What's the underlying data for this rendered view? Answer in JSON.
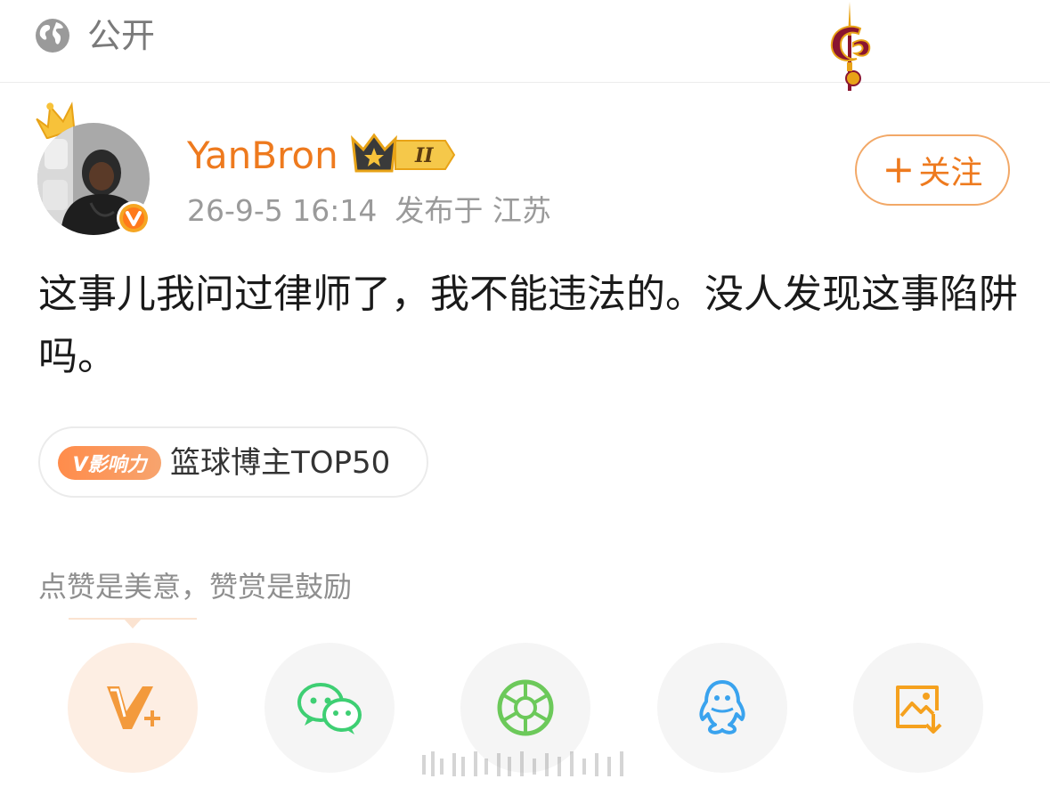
{
  "header": {
    "visibility_icon": "globe-icon",
    "visibility_label": "公开",
    "team_logo_icon": "basketball-team-logo"
  },
  "author": {
    "name": "YanBron",
    "crown_icon": "crown-icon",
    "verified_icon": "verified-v-icon",
    "rank_badge_icon": "crown-rank-badge",
    "rank_level": "II",
    "date": "26-9-5 16:14",
    "location": "发布于 江苏",
    "name_color": "#ee7a1e"
  },
  "follow_button": {
    "label": "关注",
    "icon": "plus-icon"
  },
  "post": {
    "text": "这事儿我问过律师了，我不能违法的。没人发现这事陷阱吗。"
  },
  "influence_tag": {
    "badge": "V影响力",
    "label": "篮球博主TOP50"
  },
  "reward": {
    "note": "点赞是美意，赞赏是鼓励"
  },
  "share_actions": [
    {
      "icon": "v-plus-icon"
    },
    {
      "icon": "wechat-icon"
    },
    {
      "icon": "moments-icon"
    },
    {
      "icon": "qq-icon"
    },
    {
      "icon": "save-image-icon"
    }
  ],
  "colors": {
    "accent": "#ee7a1e",
    "follow_border": "#f2a867",
    "text_primary": "#1a1a1a",
    "text_secondary": "#9a9a9a",
    "wechat": "#3ecf73",
    "moments": "#6cc95a",
    "qq": "#3aa3ee",
    "save": "#f5a11e"
  }
}
